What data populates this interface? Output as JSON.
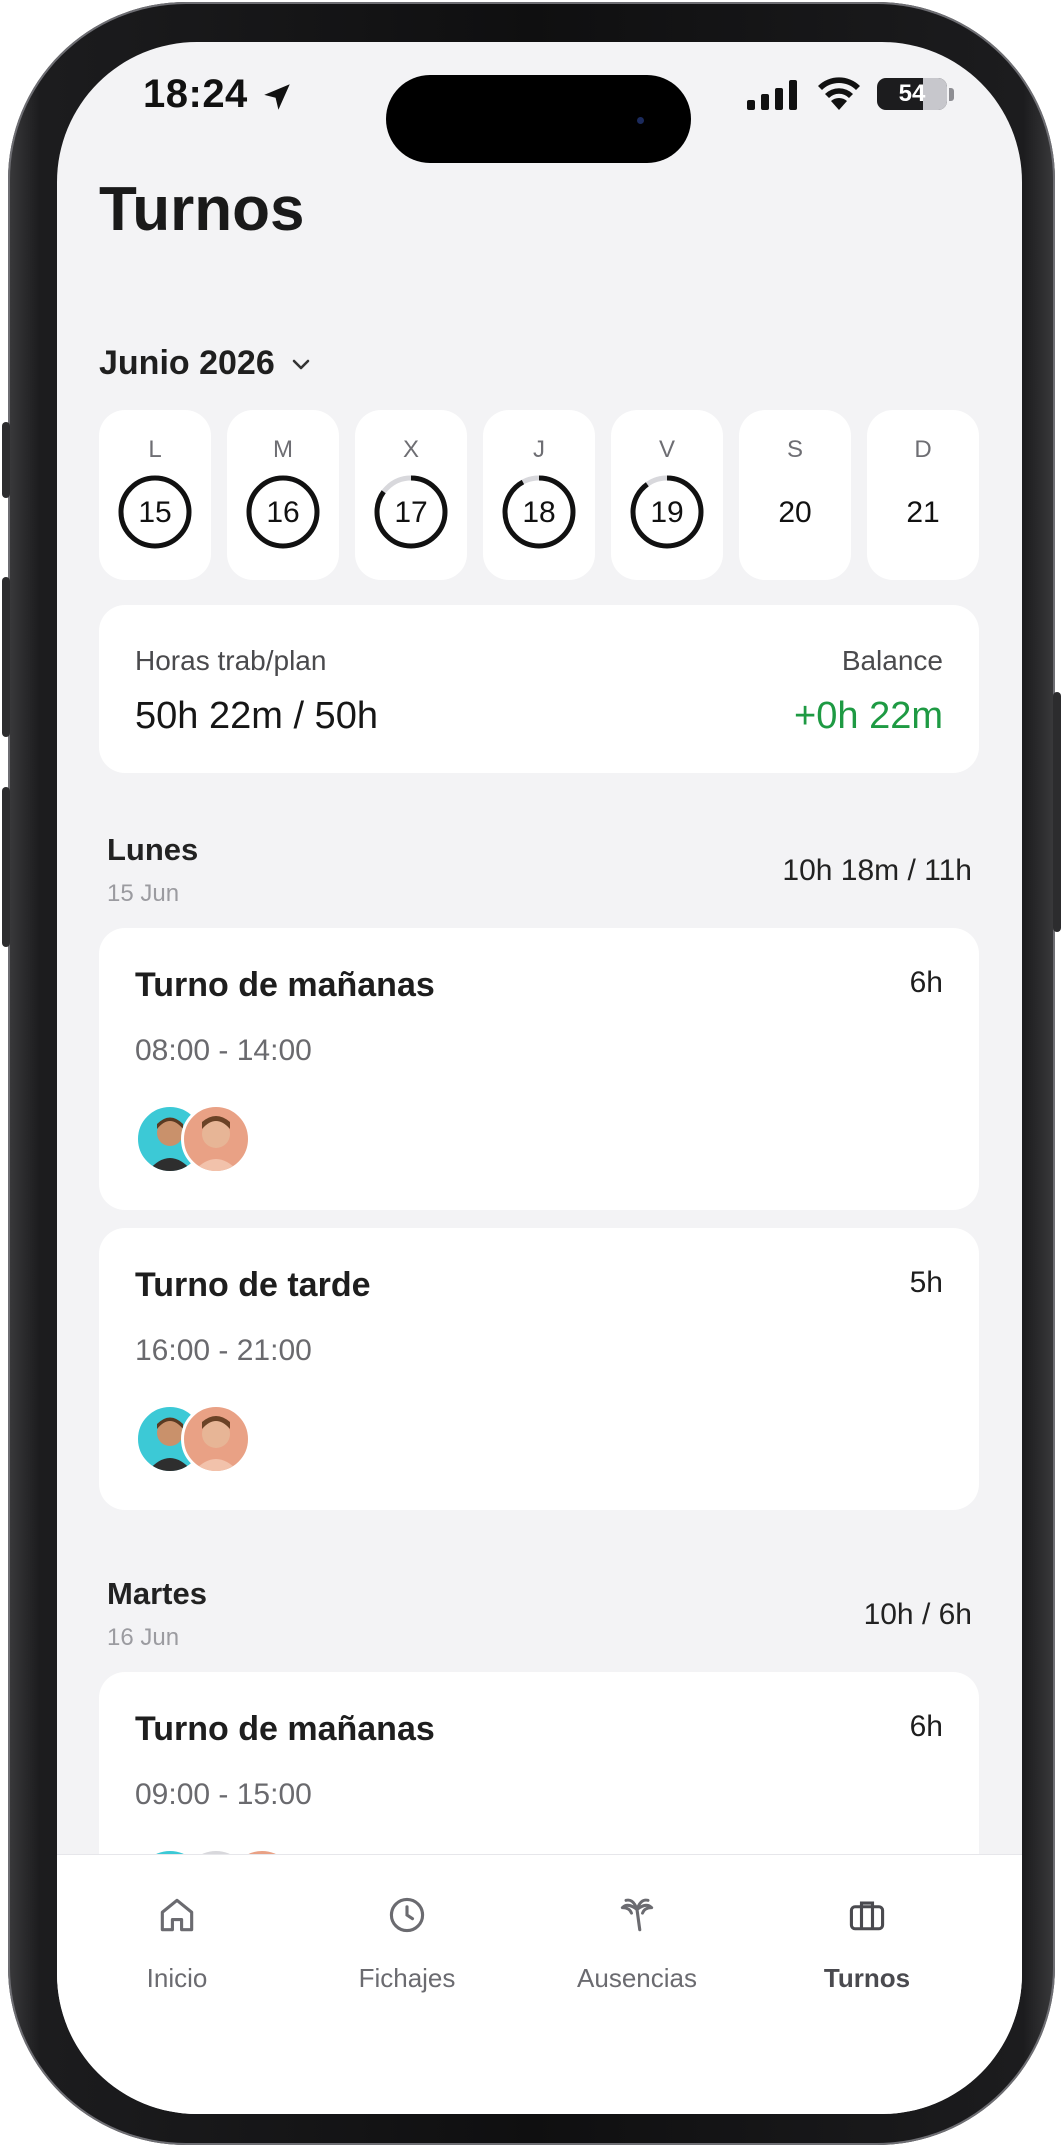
{
  "status_bar": {
    "time": "18:24",
    "battery_level": "54",
    "icons": [
      "location-arrow-icon",
      "cellular-signal-icon",
      "wifi-icon",
      "battery-icon"
    ]
  },
  "page": {
    "title": "Turnos"
  },
  "month_selector": {
    "label": "Junio 2026",
    "icon": "chevron-down-icon"
  },
  "week": [
    {
      "letter": "L",
      "number": "15",
      "progress": 1.0
    },
    {
      "letter": "M",
      "number": "16",
      "progress": 1.0
    },
    {
      "letter": "X",
      "number": "17",
      "progress": 0.85
    },
    {
      "letter": "J",
      "number": "18",
      "progress": 0.92
    },
    {
      "letter": "V",
      "number": "19",
      "progress": 0.9
    },
    {
      "letter": "S",
      "number": "20",
      "progress": null
    },
    {
      "letter": "D",
      "number": "21",
      "progress": null
    }
  ],
  "summary": {
    "worked_label": "Horas trab/plan",
    "worked_value": "50h 22m / 50h",
    "balance_label": "Balance",
    "balance_value": "+0h 22m",
    "balance_color": "#1e9a43"
  },
  "days": [
    {
      "name": "Lunes",
      "date": "15 Jun",
      "hours": "10h 18m / 11h",
      "shifts": [
        {
          "title": "Turno de mañanas",
          "duration": "6h",
          "time": "08:00 - 14:00"
        },
        {
          "title": "Turno de tarde",
          "duration": "5h",
          "time": "16:00 - 21:00"
        }
      ]
    },
    {
      "name": "Martes",
      "date": "16 Jun",
      "hours": "10h / 6h",
      "shifts": [
        {
          "title": "Turno de mañanas",
          "duration": "6h",
          "time": "09:00 - 15:00"
        }
      ]
    }
  ],
  "tabbar": {
    "items": [
      {
        "label": "Inicio",
        "icon": "home-icon"
      },
      {
        "label": "Fichajes",
        "icon": "clock-icon"
      },
      {
        "label": "Ausencias",
        "icon": "palm-tree-icon"
      },
      {
        "label": "Turnos",
        "icon": "briefcase-icon"
      }
    ],
    "active": "Turnos"
  }
}
